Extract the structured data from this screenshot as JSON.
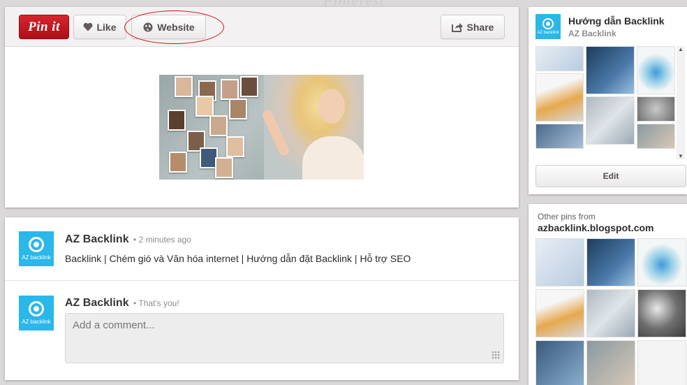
{
  "background": {
    "watermark": "Pinterest"
  },
  "pin": {
    "pin_it_label": "Pin it",
    "like_label": "Like",
    "website_label": "Website",
    "share_label": "Share"
  },
  "comments": [
    {
      "author": "AZ Backlink",
      "meta": "• 2 minutes ago",
      "text": "Backlink | Chém gió và Văn hóa internet | Hướng dẫn đặt Backlink | Hỗ trợ SEO",
      "avatar_text": "AZ backlink"
    },
    {
      "author": "AZ Backlink",
      "meta": "• That's you!",
      "avatar_text": "AZ backlink"
    }
  ],
  "comment_input": {
    "placeholder": "Add a comment..."
  },
  "board": {
    "title": "Hướng dẫn Backlink",
    "owner": "AZ Backlink",
    "edit_label": "Edit",
    "avatar_text": "AZ backlink"
  },
  "other_pins": {
    "label": "Other pins from",
    "domain": "azbacklink.blogspot.com"
  },
  "colors": {
    "pin_red": "#c41a21",
    "avatar_blue": "#2ab7ea",
    "annotation_red": "#c8141b"
  },
  "icons": {
    "like": "heart-icon",
    "website": "globe-icon",
    "share": "share-arrow-icon"
  }
}
